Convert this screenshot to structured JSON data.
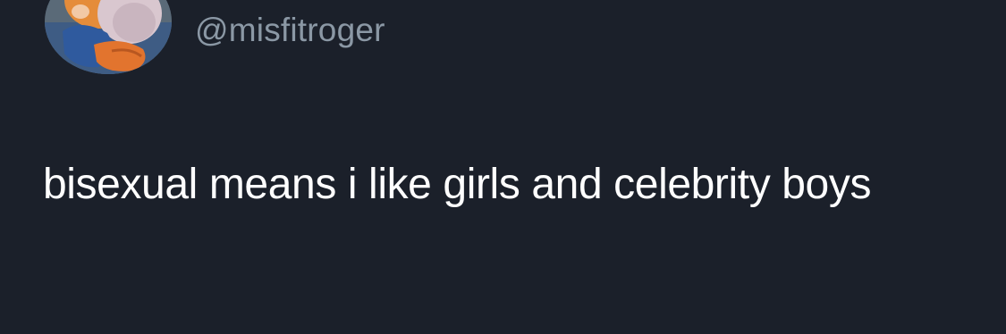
{
  "tweet": {
    "handle": "@misfitroger",
    "text": "bisexual means i like girls and celebrity boys"
  },
  "colors": {
    "background": "#1b202a",
    "text": "#ffffff",
    "handle": "#8b98a5"
  },
  "icons": {
    "avatar": "cartoon-character-avatar"
  }
}
